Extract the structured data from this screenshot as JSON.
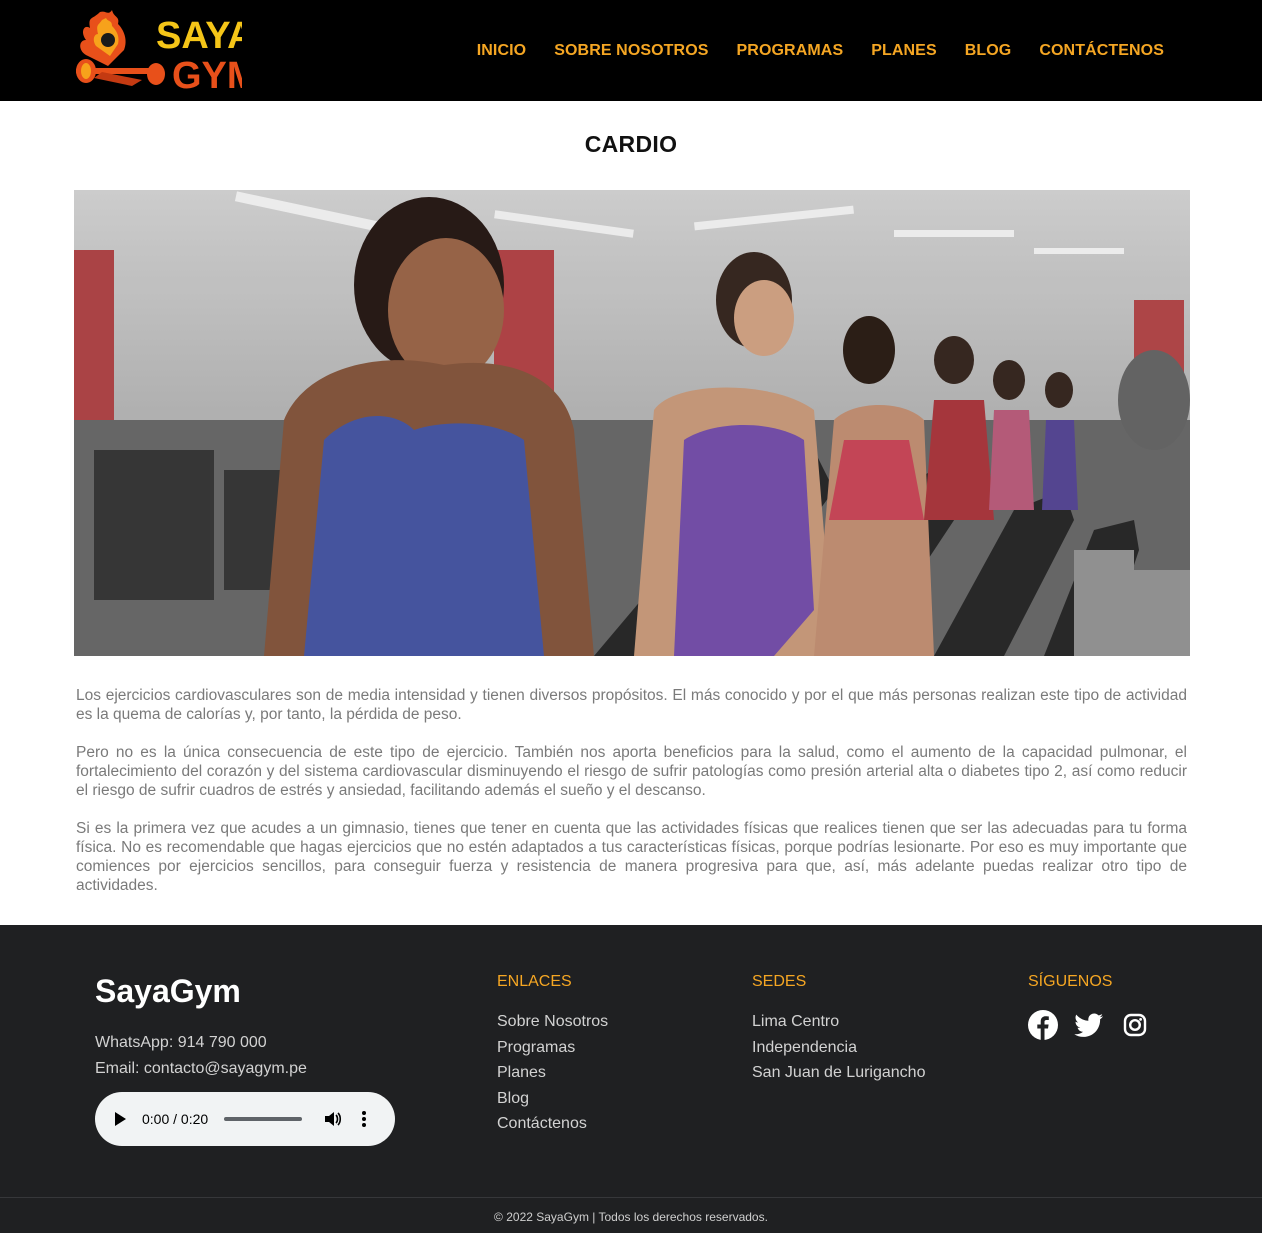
{
  "header": {
    "logo_text": [
      "SAYA",
      "GYM"
    ],
    "logo_alt": "Saya Gym logo",
    "nav": [
      {
        "label": "INICIO"
      },
      {
        "label": "SOBRE NOSOTROS"
      },
      {
        "label": "PROGRAMAS"
      },
      {
        "label": "PLANES"
      },
      {
        "label": "BLOG"
      },
      {
        "label": "CONTÁCTENOS"
      }
    ],
    "accent_color": "#f5a623"
  },
  "main": {
    "title": "CARDIO",
    "hero_image": "people running on treadmills in a gym",
    "paragraphs": [
      "Los ejercicios cardiovasculares son de media intensidad y tienen diversos propósitos. El más conocido y por el que más personas realizan este tipo de actividad es la quema de calorías y, por tanto, la pérdida de peso.",
      "Pero no es la única consecuencia de este tipo de ejercicio. También nos aporta beneficios para la salud, como el aumento de la capacidad pulmonar, el fortalecimiento del corazón y del sistema cardiovascular disminuyendo el riesgo de sufrir patologías como presión arterial alta o diabetes tipo 2, así como reducir el riesgo de sufrir cuadros de estrés y ansiedad, facilitando además el sueño y el descanso.",
      "Si es la primera vez que acudes a un gimnasio, tienes que tener en cuenta que las actividades físicas que realices tienen que ser las adecuadas para tu forma física. No es recomendable que hagas ejercicios que no estén adaptados a tus características físicas, porque podrías lesionarte. Por eso es muy importante que comiences por ejercicios sencillos, para conseguir fuerza y resistencia de manera progresiva para que, así, más adelante puedas realizar otro tipo de actividades."
    ]
  },
  "footer": {
    "brand": "SayaGym",
    "whatsapp": "WhatsApp: 914 790 000",
    "email": "Email: contacto@sayagym.pe",
    "audio": {
      "time": "0:00 / 0:20"
    },
    "links_heading": "ENLACES",
    "links": [
      "Sobre Nosotros",
      "Programas",
      "Planes",
      "Blog",
      "Contáctenos"
    ],
    "sedes_heading": "SEDES",
    "sedes": [
      "Lima Centro",
      "Independencia",
      "San Juan de Lurigancho"
    ],
    "social_heading": "SÍGUENOS",
    "social_icons": [
      "facebook-icon",
      "twitter-icon",
      "instagram-icon"
    ],
    "copyright": "© 2022 SayaGym | Todos los derechos reservados.",
    "background_color": "#1f2022"
  }
}
